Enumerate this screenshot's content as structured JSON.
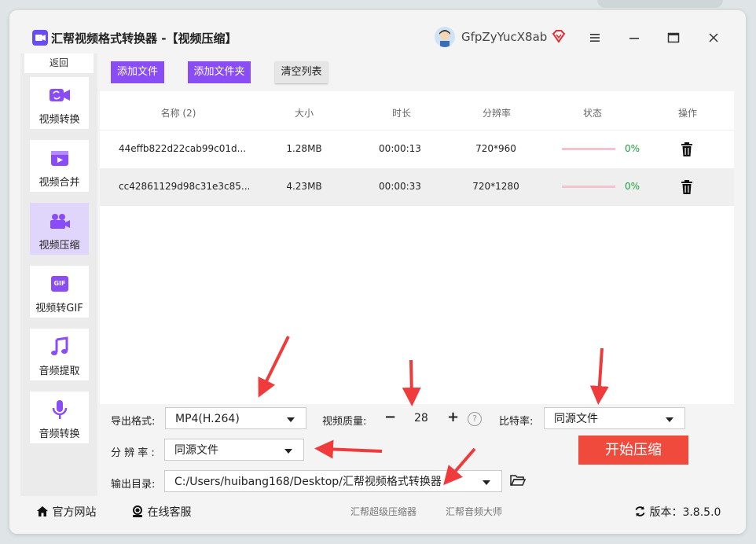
{
  "app": {
    "title": "汇帮视频格式转换器  -【视频压缩】"
  },
  "user": {
    "name": "GfpZyYucX8ab"
  },
  "colors": {
    "accent": "#8a4df5",
    "start_button": "#ef4a3c",
    "progress": "#1a9e3a",
    "active_nav": "#e0d6fb"
  },
  "sidebar": {
    "back_label": "返回",
    "items": [
      {
        "label": "视频转换",
        "icon": "video-convert-icon"
      },
      {
        "label": "视频合并",
        "icon": "video-merge-icon"
      },
      {
        "label": "视频压缩",
        "icon": "video-compress-icon"
      },
      {
        "label": "视频转GIF",
        "icon": "gif-icon"
      },
      {
        "label": "音频提取",
        "icon": "music-note-icon"
      },
      {
        "label": "音频转换",
        "icon": "microphone-icon"
      }
    ]
  },
  "toolbar": {
    "add_file": "添加文件",
    "add_folder": "添加文件夹",
    "clear_list": "清空列表"
  },
  "table": {
    "headers": [
      "名称 (2)",
      "大小",
      "时长",
      "分辨率",
      "状态",
      "操作"
    ],
    "rows": [
      {
        "name": "44effb822d22cab99c01d...",
        "size": "1.28MB",
        "duration": "00:00:13",
        "resolution": "720*960",
        "progress": "0%"
      },
      {
        "name": "cc42861129d98c31e3c85...",
        "size": "4.23MB",
        "duration": "00:00:33",
        "resolution": "720*1280",
        "progress": "0%"
      }
    ]
  },
  "settings": {
    "format_label": "导出格式:",
    "format_value": "MP4(H.264)",
    "quality_label": "视频质量:",
    "quality_value": "28",
    "minus": "−",
    "plus": "+",
    "help": "?",
    "bitrate_label": "比特率:",
    "bitrate_value": "同源文件",
    "resolution_label": "分 辨 率 :",
    "resolution_value": "同源文件",
    "output_label": "输出目录:",
    "output_value": "C:/Users/huibang168/Desktop/汇帮视频格式转换器",
    "start_label": "开始压缩"
  },
  "footer": {
    "website": "官方网站",
    "support": "在线客服",
    "link1": "汇帮超级压缩器",
    "link2": "汇帮音频大师",
    "version_label": "版本：",
    "version": "3.8.5.0"
  }
}
